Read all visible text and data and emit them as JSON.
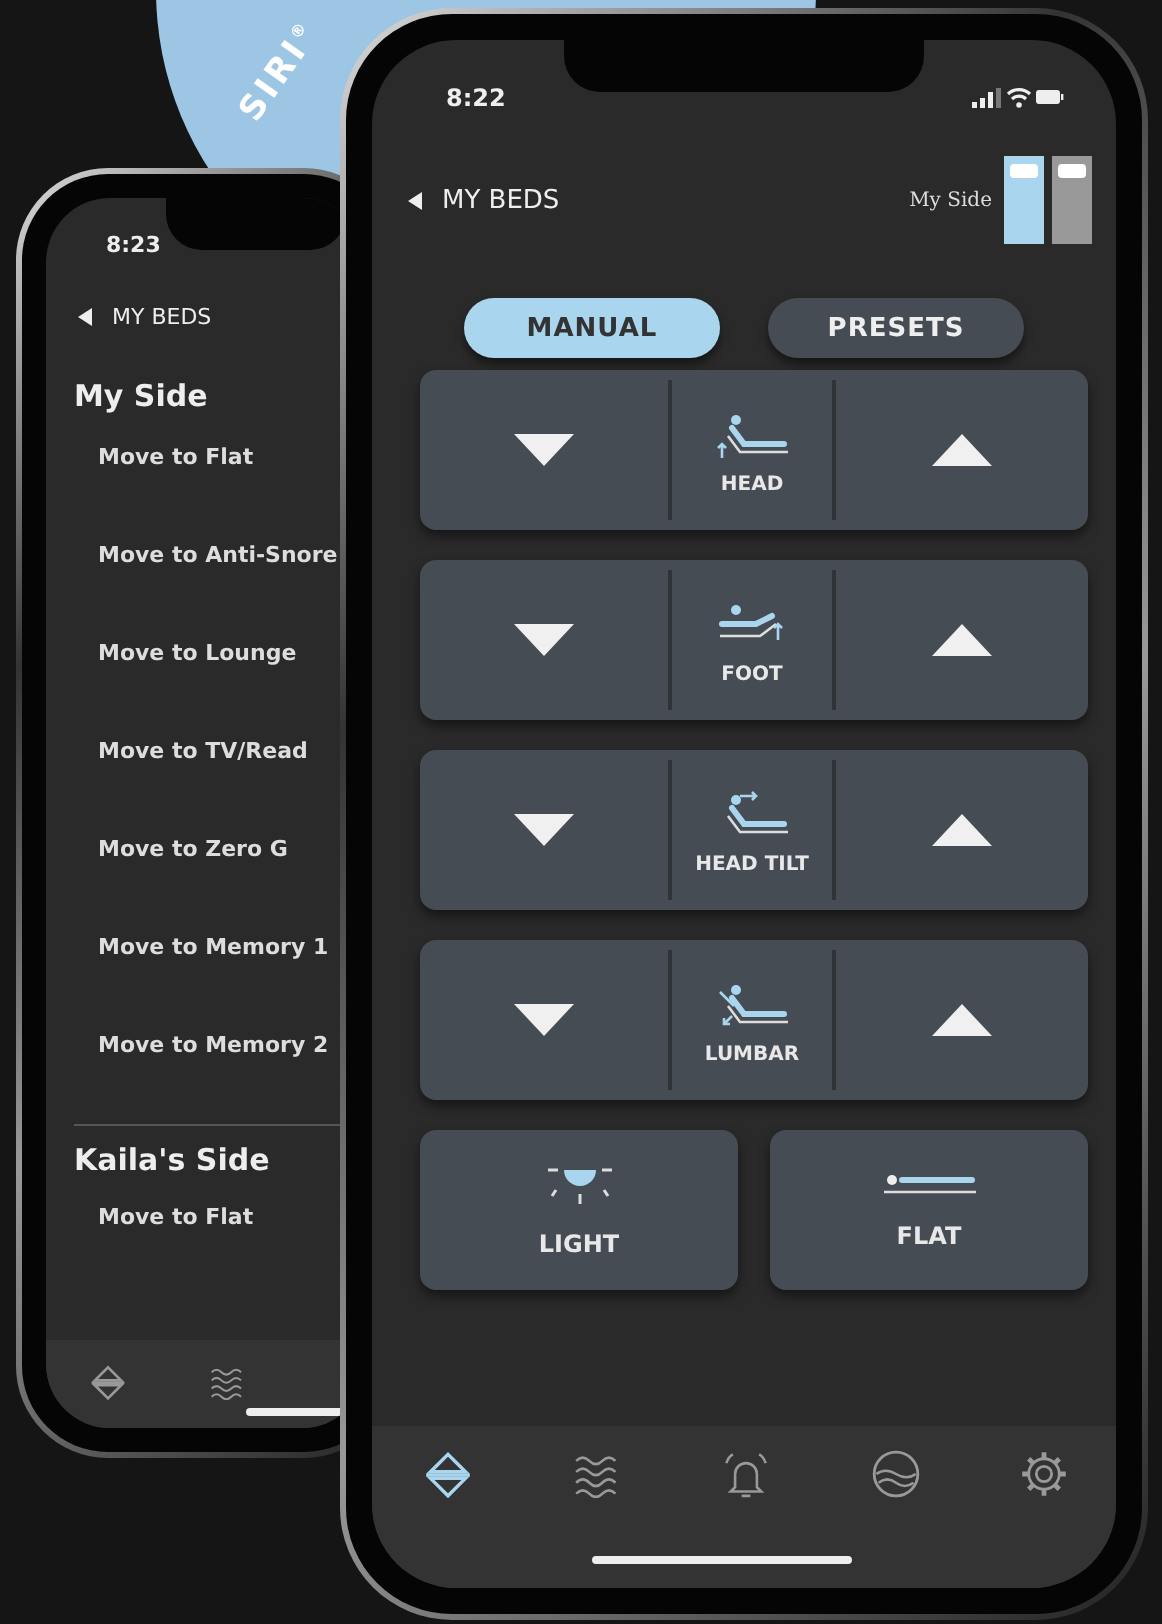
{
  "badge": {
    "text": "SIRI$^{®}$"
  },
  "back_phone": {
    "time": "8:23",
    "back_label": "MY BEDS",
    "sections": [
      {
        "title": "My Side",
        "items": [
          "Move to Flat",
          "Move to Anti-Snore",
          "Move to Lounge",
          "Move to TV/Read",
          "Move to Zero G",
          "Move to Memory 1",
          "Move to Memory 2"
        ]
      },
      {
        "title": "Kaila's Side",
        "items": [
          "Move to Flat"
        ]
      }
    ],
    "nav": [
      {
        "selected": false
      },
      {
        "selected": false
      }
    ]
  },
  "front_phone": {
    "time": "8:22",
    "back_label": "MY BEDS",
    "side_label": "My Side",
    "sides": [
      {
        "selected": true
      },
      {
        "selected": false
      }
    ],
    "tabs": [
      {
        "label": "MANUAL",
        "selected": true
      },
      {
        "label": "PRESETS",
        "selected": false
      }
    ],
    "controls": [
      {
        "label": "HEAD"
      },
      {
        "label": "FOOT"
      },
      {
        "label": "HEAD TILT"
      },
      {
        "label": "LUMBAR"
      }
    ],
    "buttons": [
      {
        "label": "LIGHT"
      },
      {
        "label": "FLAT"
      }
    ],
    "nav": [
      {
        "selected": true
      },
      {
        "selected": false
      },
      {
        "selected": false
      },
      {
        "selected": false
      },
      {
        "selected": false
      }
    ]
  }
}
